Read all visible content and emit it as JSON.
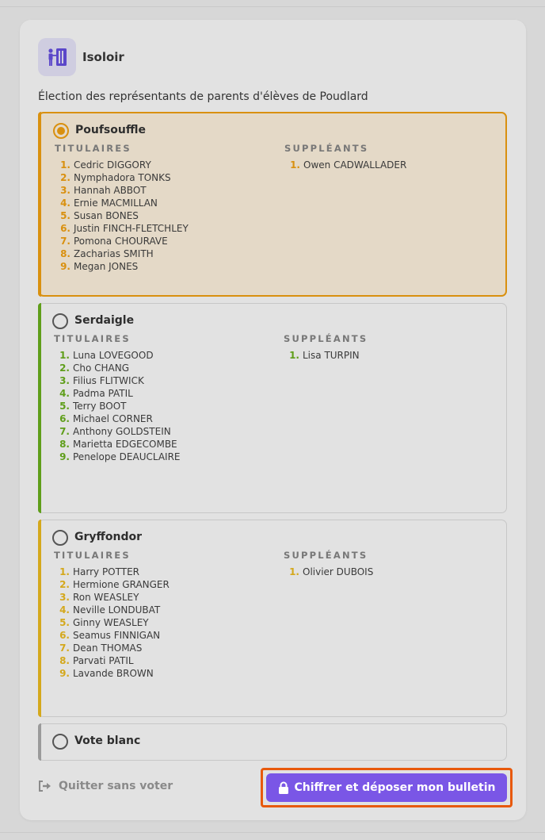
{
  "app": {
    "title": "Isoloir",
    "icon": "voting-booth-icon"
  },
  "election": {
    "title": "Élection des représentants de parents d'élèves de Poudlard"
  },
  "labels": {
    "titulaires": "TITULAIRES",
    "suppleants": "SUPPLÉANTS"
  },
  "colors": {
    "accent_poufsouffle": "#d9900f",
    "accent_serdaigle": "#5f9e1a",
    "accent_gryffondor": "#d4a81c",
    "accent_blank": "#9a9a9a",
    "primary_button": "#7a56e6",
    "focus_ring": "#e8590c"
  },
  "lists": [
    {
      "name": "Poufsouffle",
      "selected": true,
      "titulaires": [
        {
          "num": "1.",
          "name": "Cedric DIGGORY"
        },
        {
          "num": "2.",
          "name": "Nymphadora TONKS"
        },
        {
          "num": "3.",
          "name": "Hannah ABBOT"
        },
        {
          "num": "4.",
          "name": "Ernie MACMILLAN"
        },
        {
          "num": "5.",
          "name": "Susan BONES"
        },
        {
          "num": "6.",
          "name": "Justin FINCH-FLETCHLEY"
        },
        {
          "num": "7.",
          "name": "Pomona CHOURAVE"
        },
        {
          "num": "8.",
          "name": "Zacharias SMITH"
        },
        {
          "num": "9.",
          "name": "Megan JONES"
        }
      ],
      "suppleants": [
        {
          "num": "1.",
          "name": "Owen CADWALLADER"
        }
      ]
    },
    {
      "name": "Serdaigle",
      "selected": false,
      "titulaires": [
        {
          "num": "1.",
          "name": "Luna LOVEGOOD"
        },
        {
          "num": "2.",
          "name": "Cho CHANG"
        },
        {
          "num": "3.",
          "name": "Filius FLITWICK"
        },
        {
          "num": "4.",
          "name": "Padma PATIL"
        },
        {
          "num": "5.",
          "name": "Terry BOOT"
        },
        {
          "num": "6.",
          "name": "Michael CORNER"
        },
        {
          "num": "7.",
          "name": "Anthony GOLDSTEIN"
        },
        {
          "num": "8.",
          "name": "Marietta EDGECOMBE"
        },
        {
          "num": "9.",
          "name": "Penelope DEAUCLAIRE"
        }
      ],
      "suppleants": [
        {
          "num": "1.",
          "name": "Lisa TURPIN"
        }
      ]
    },
    {
      "name": "Gryffondor",
      "selected": false,
      "titulaires": [
        {
          "num": "1.",
          "name": "Harry POTTER"
        },
        {
          "num": "2.",
          "name": "Hermione GRANGER"
        },
        {
          "num": "3.",
          "name": "Ron WEASLEY"
        },
        {
          "num": "4.",
          "name": "Neville LONDUBAT"
        },
        {
          "num": "5.",
          "name": "Ginny WEASLEY"
        },
        {
          "num": "6.",
          "name": "Seamus FINNIGAN"
        },
        {
          "num": "7.",
          "name": "Dean THOMAS"
        },
        {
          "num": "8.",
          "name": "Parvati PATIL"
        },
        {
          "num": "9.",
          "name": "Lavande BROWN"
        }
      ],
      "suppleants": [
        {
          "num": "1.",
          "name": "Olivier DUBOIS"
        }
      ]
    }
  ],
  "blank_vote": {
    "label": "Vote blanc",
    "selected": false
  },
  "actions": {
    "quit_label": "Quitter sans voter",
    "quit_icon": "sign-out-icon",
    "submit_label": "Chiffrer et déposer mon bulletin",
    "submit_icon": "lock-icon"
  }
}
